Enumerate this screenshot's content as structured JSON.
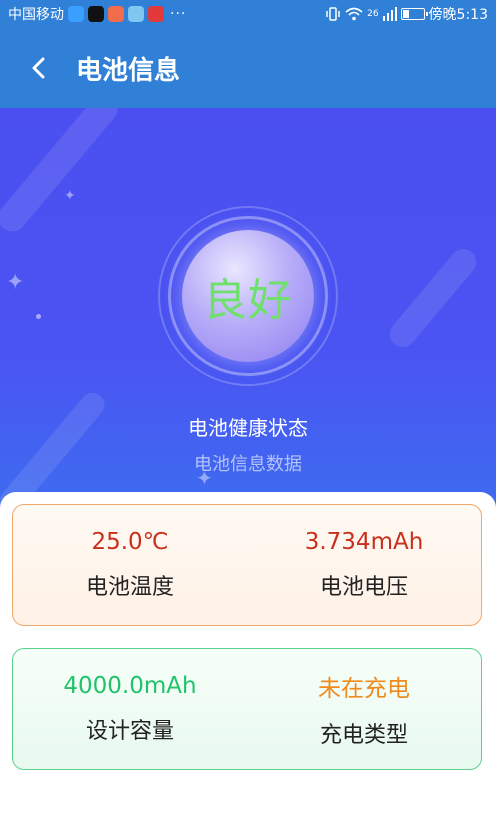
{
  "status_bar": {
    "carrier": "中国移动",
    "signal_label": "26",
    "time": "傍晚5:13",
    "more": "···",
    "battery_level": 0.35
  },
  "header": {
    "title": "电池信息"
  },
  "hero": {
    "health_status": "良好",
    "health_title": "电池健康状态",
    "subtitle": "电池信息数据"
  },
  "cards": {
    "temperature": {
      "value": "25.0℃",
      "label": "电池温度"
    },
    "voltage": {
      "value": "3.734mAh",
      "label": "电池电压"
    },
    "capacity": {
      "value": "4000.0mAh",
      "label": "设计容量"
    },
    "charging": {
      "value": "未在充电",
      "label": "充电类型"
    }
  },
  "colors": {
    "app_bar": "#2f80d6",
    "hero": "#4a54f2",
    "health_text": "#6ee06b",
    "red_value": "#c9301b",
    "green_value": "#21c36a",
    "orange_value": "#f08a1d"
  }
}
